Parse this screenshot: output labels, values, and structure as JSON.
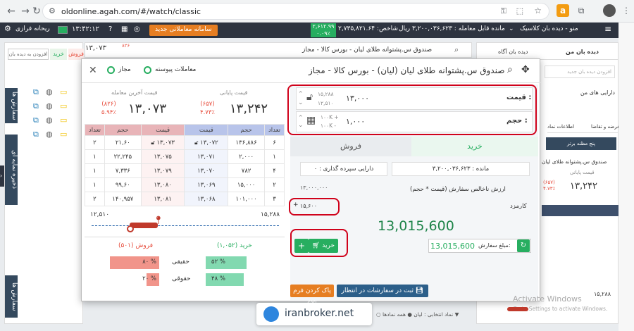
{
  "browser": {
    "url": "oldonline.agah.com/#/watch/classic"
  },
  "header": {
    "menu_label": "منو - دیده بان کلاسیک",
    "remaining_label": "مانده قابل معامله : ۳,۲۰۰,۰۳۶,۶۲۳ ریال",
    "index_label": "شاخص: ۲,۷۳۵,۸۲۱.۶۴",
    "index_change": "۲,۶۱۲.۹۹",
    "index_pct": "۰.۰۹٪",
    "new_trading_btn": "سامانه معاملاتی جدید",
    "time": "۱۳:۴۲:۱۲",
    "invest_label": "ریحانه فرازی"
  },
  "right_panel": {
    "tabs": [
      "دیده بان من",
      "دیده بان آگاه"
    ],
    "search_placeholder": "افزودن دیده بان جدید",
    "my_assets": "دارایی های من",
    "sub_tabs": [
      "عرضه و تقاضا",
      "اطلاعات نماد"
    ],
    "best_five": "پنج مظنه برتر",
    "symbol": "صندوق س.پشتوانه طلای لیان",
    "last_price_label": "قیمت پایانی",
    "last_price": "۱۳,۲۴۲",
    "last_change": "(۶۵۷)",
    "last_pct": "۴.۷۳٪",
    "row_max": "۱۵,۲۸۸"
  },
  "left_panel": {
    "vtab1": "سفارش ها",
    "vtab2": "ذخیره نمایه ای",
    "vtab3": "سفارش ها",
    "add_to_watch": "افزودن به دیده بان",
    "buy_short": "خرید",
    "sell_short": "فروش",
    "price": "۱۳,۰۷۳",
    "change": "۸۲۶"
  },
  "bg_symbol_bar": "صندوق س.پشتوانه طلای لیان - بورس کالا - مجاز",
  "modal": {
    "title": "صندوق س.پشتوانه طلای لیان (لیان) - بورس کالا - مجاز",
    "continuous_label": "معاملات پیوسته",
    "allowed_label": "مجاز",
    "closing_price_label": "قیمت پایانی",
    "closing_price": "۱۳,۲۴۲",
    "closing_change": "(۶۵۷)",
    "closing_pct": "۴.۷۳٪",
    "last_trade_label": "قیمت آخرین معامله",
    "last_trade": "۱۳,۰۷۳",
    "last_change": "(۸۲۶)",
    "last_pct": "۵.۹۴٪",
    "ob_headers": [
      "تعداد",
      "حجم",
      "قیمت",
      "قیمت",
      "حجم",
      "تعداد"
    ],
    "ob_rows": [
      [
        "۶",
        "۱۳۶,۸۸۶",
        "۱۳,۰۷۲",
        "۱۳,۰۷۳",
        "۲۱,۶۰",
        "۲"
      ],
      [
        "۱",
        "۲,۰۰۰",
        "۱۳,۰۷۱",
        "۱۳,۰۷۵",
        "۲۲,۲۴۵",
        "۱"
      ],
      [
        "۴",
        "۷۸۲",
        "۱۳,۰۷۰",
        "۱۳,۰۷۹",
        "۷,۳۳۶",
        "۱"
      ],
      [
        "۲",
        "۱۵,۰۰۰",
        "۱۳,۰۶۹",
        "۱۳,۰۸۰",
        "۹۹,۶۰",
        "۱"
      ],
      [
        "۳",
        "۱۰۱,۰۰۰",
        "۱۳,۰۶۸",
        "۱۳,۰۸۱",
        "۱۴۰,۹۵۷",
        "۲"
      ]
    ],
    "range_min": "۱۲,۵۱۰",
    "range_max": "۱۵,۲۸۸",
    "buy_count": "خرید (۱,۰۵۲)",
    "sell_count": "فروش (۵۰۱)",
    "real_label": "حقیقی",
    "legal_label": "حقوقی",
    "buy_real_pct": "۵۲ %",
    "buy_legal_pct": "۴۸ %",
    "sell_real_pct": "۸۰ %",
    "sell_legal_pct": "۲۰ %",
    "buy_real_frac": 0.52,
    "buy_legal_frac": 0.48,
    "sell_real_frac": 0.8,
    "sell_legal_frac": 0.2,
    "price_label": "قیمت :",
    "price_value": "۱۳,۰۰۰",
    "price_upper": "۱۵,۲۸۸",
    "price_lower": "۱۲,۵۱۰",
    "volume_label": "حجم :",
    "volume_value": "۱,۰۰۰",
    "vol_plus": "۱۰۰K +",
    "vol_minus": "۱۰۰K -",
    "tab_buy": "خرید",
    "tab_sell": "فروش",
    "remaining_label": "مانده : ۳,۲۰۰,۰۳۶,۶۲۳",
    "credit_label": "دارایی سپرده گذاری : ۰",
    "gross_label": "ارزش ناخالص سفارش (قیمت * حجم)",
    "gross_value": "۱۳,۰۰۰,۰۰۰",
    "fee_label": "کارمزد",
    "fee_value": "۱۵,۶۰۰",
    "total": "13,015,600",
    "order_amount_label": "مبلغ سفارش:",
    "order_amount": "13,015,600",
    "buy_btn": "خرید",
    "save_btn": "ثبت در سفارشات در انتظار",
    "clear_btn": "پاک کردن فرم"
  },
  "footer": {
    "watermark": "iranbroker.net",
    "all_symbols": "همه نمادها",
    "selected_symbol": "نماد انتخابی : لیان",
    "activate1": "Activate Windows",
    "activate2": "Go to Settings to activate Windows."
  },
  "colors": {
    "buy": "#27ae60",
    "sell": "#e74c3c",
    "accent": "#e67e22",
    "header": "#2e3440"
  }
}
